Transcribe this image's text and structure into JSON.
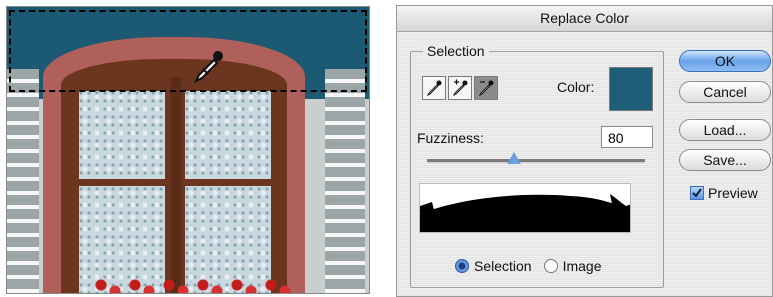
{
  "dialog": {
    "title": "Replace Color",
    "selection_group_label": "Selection",
    "color_label": "Color:",
    "selected_color": "#1f5e78",
    "fuzziness_label": "Fuzziness:",
    "fuzziness_value": "80",
    "fuzziness_fraction": 0.4,
    "tools": [
      {
        "icon": "eyedropper-icon",
        "active": false
      },
      {
        "icon": "eyedropper-plus-icon",
        "active": false
      },
      {
        "icon": "eyedropper-minus-icon",
        "active": true
      }
    ],
    "view_options": [
      {
        "label": "Selection",
        "selected": true
      },
      {
        "label": "Image",
        "selected": false
      }
    ],
    "buttons": {
      "ok": "OK",
      "cancel": "Cancel",
      "load": "Load...",
      "save": "Save..."
    },
    "preview_label": "Preview",
    "preview_checked": true
  },
  "photo": {
    "cursor_icon": "eyedropper-cursor-icon"
  }
}
